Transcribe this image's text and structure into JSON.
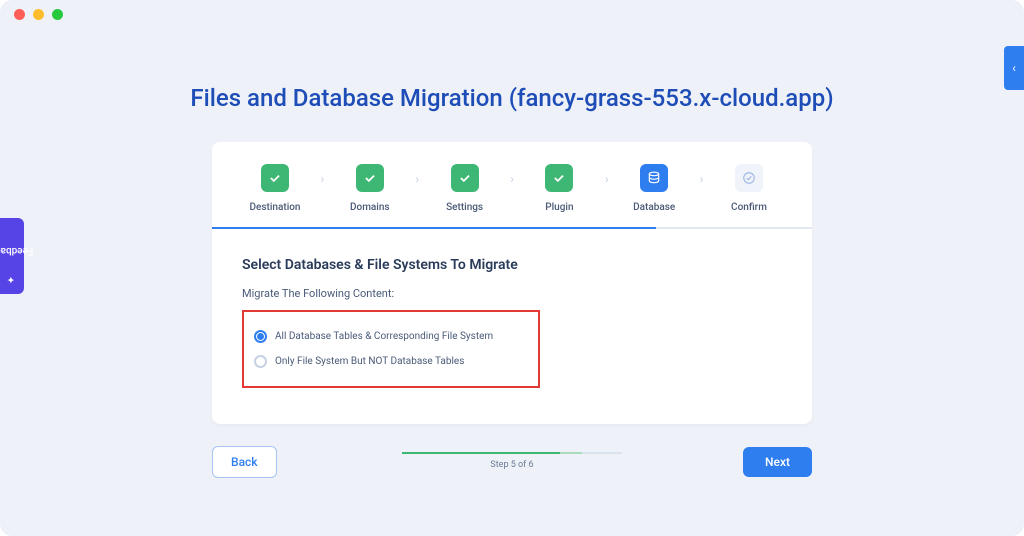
{
  "page_title": "Files and Database Migration (fancy-grass-553.x-cloud.app)",
  "stepper": {
    "steps": [
      {
        "label": "Destination",
        "state": "done"
      },
      {
        "label": "Domains",
        "state": "done"
      },
      {
        "label": "Settings",
        "state": "done"
      },
      {
        "label": "Plugin",
        "state": "done"
      },
      {
        "label": "Database",
        "state": "active",
        "icon": "db"
      },
      {
        "label": "Confirm",
        "state": "pending",
        "icon": "confirm"
      }
    ]
  },
  "section": {
    "title": "Select Databases & File Systems To Migrate",
    "subhead": "Migrate The Following Content:",
    "options": [
      {
        "label": "All Database Tables & Corresponding File System",
        "selected": true
      },
      {
        "label": "Only File System But NOT Database Tables",
        "selected": false
      }
    ]
  },
  "footer": {
    "back_label": "Back",
    "next_label": "Next",
    "progress_text": "Step 5 of 6"
  },
  "feedback_label": "Feedback"
}
